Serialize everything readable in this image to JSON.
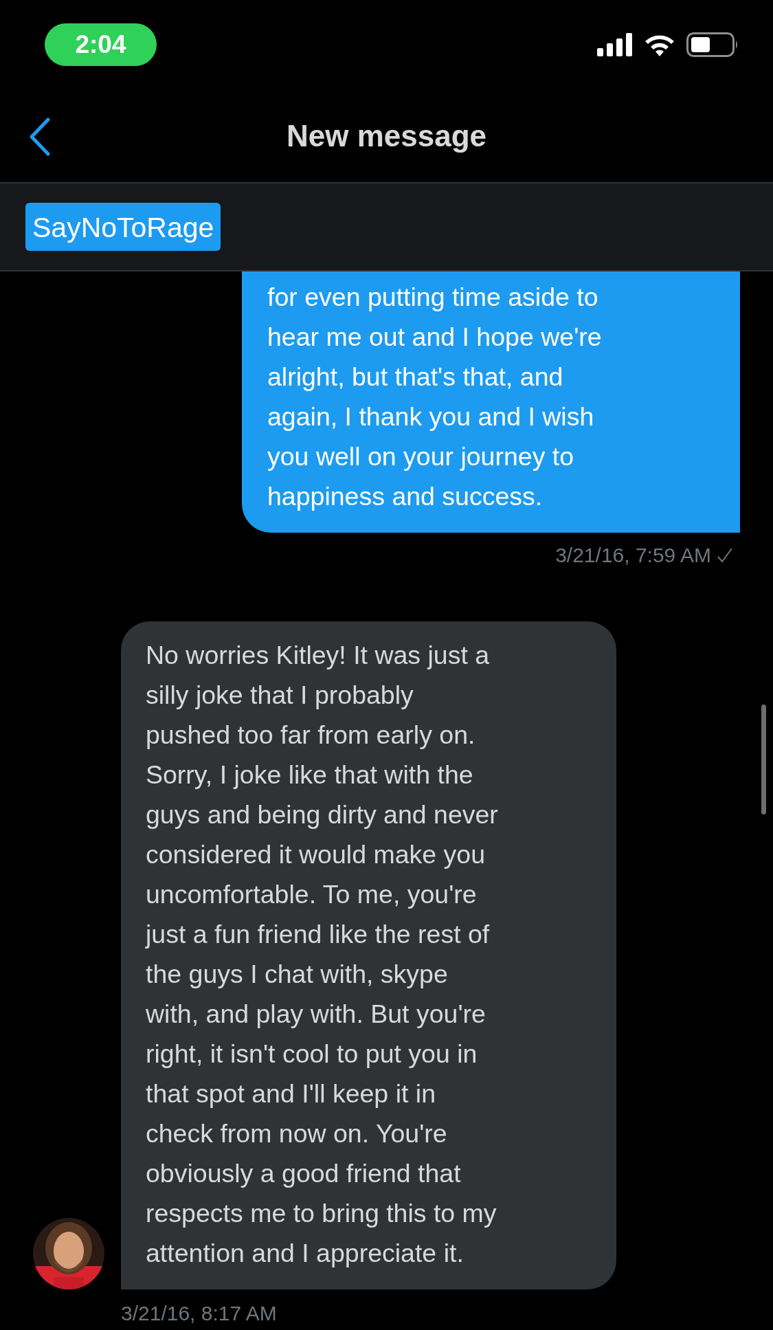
{
  "status_bar": {
    "time": "2:04"
  },
  "header": {
    "title": "New message"
  },
  "recipients": [
    {
      "name": "SayNoToRage"
    }
  ],
  "messages": [
    {
      "kind": "sent",
      "lines": [
        "for even putting time aside to",
        "hear me out and I hope we're",
        "alright, but that's that, and",
        "again, I thank you and I wish",
        "you well on your journey to",
        "happiness and success."
      ],
      "timestamp": "3/21/16, 7:59 AM"
    },
    {
      "kind": "received",
      "lines": [
        "No worries Kitley! It was just a",
        "silly joke that I probably",
        "pushed too far from early on.",
        "Sorry, I joke like that with the",
        "guys and being dirty and never",
        "considered it would make you",
        "uncomfortable. To me, you're",
        "just a fun friend like the rest of",
        "the guys I chat with, skype",
        "with, and play with. But you're",
        "right, it isn't cool to put you in",
        "that spot and I'll keep it in",
        "check from now on. You're",
        "obviously a good friend that",
        "respects me to bring this to my",
        "attention and I appreciate it."
      ],
      "timestamp": "3/21/16, 8:17 AM"
    }
  ]
}
